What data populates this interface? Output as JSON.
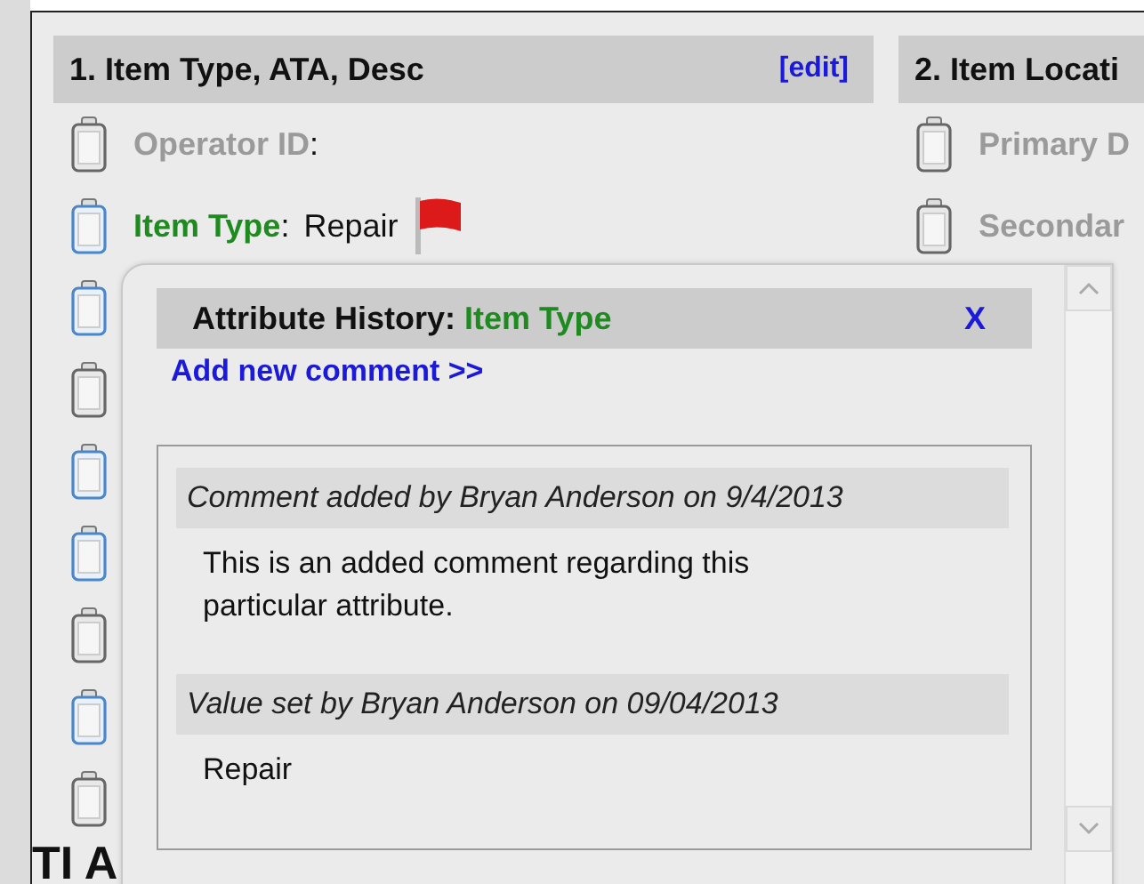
{
  "sections": [
    {
      "title": "1. Item Type, ATA, Desc",
      "edit_link": "[edit]",
      "rows": [
        {
          "label": "Operator ID",
          "separator": ":",
          "has_value": false,
          "has_history": false
        },
        {
          "label": "Item Type",
          "separator": ":",
          "value": "Repair",
          "has_value": true,
          "has_history": true,
          "flagged": true
        },
        {
          "has_history": true
        },
        {
          "has_history": false
        },
        {
          "has_history": true
        },
        {
          "has_history": true
        },
        {
          "has_history": false
        },
        {
          "has_history": true
        },
        {
          "has_history": false
        }
      ]
    },
    {
      "title": "2. Item Locati",
      "rows": [
        {
          "label": "Primary D",
          "has_value": false,
          "has_history": false
        },
        {
          "label": "Secondar",
          "has_value": false,
          "has_history": false
        }
      ]
    }
  ],
  "next_section_title": "TI A",
  "popup": {
    "title": "Attribute History:",
    "attribute": "Item Type",
    "close": "X",
    "add_comment": "Add new comment >>",
    "entries": [
      {
        "heading": "Comment added by Bryan Anderson on 9/4/2013",
        "body": "This is an added comment regarding this particular attribute."
      },
      {
        "heading": "Value set by Bryan Anderson on 09/04/2013",
        "body": "Repair"
      }
    ]
  }
}
